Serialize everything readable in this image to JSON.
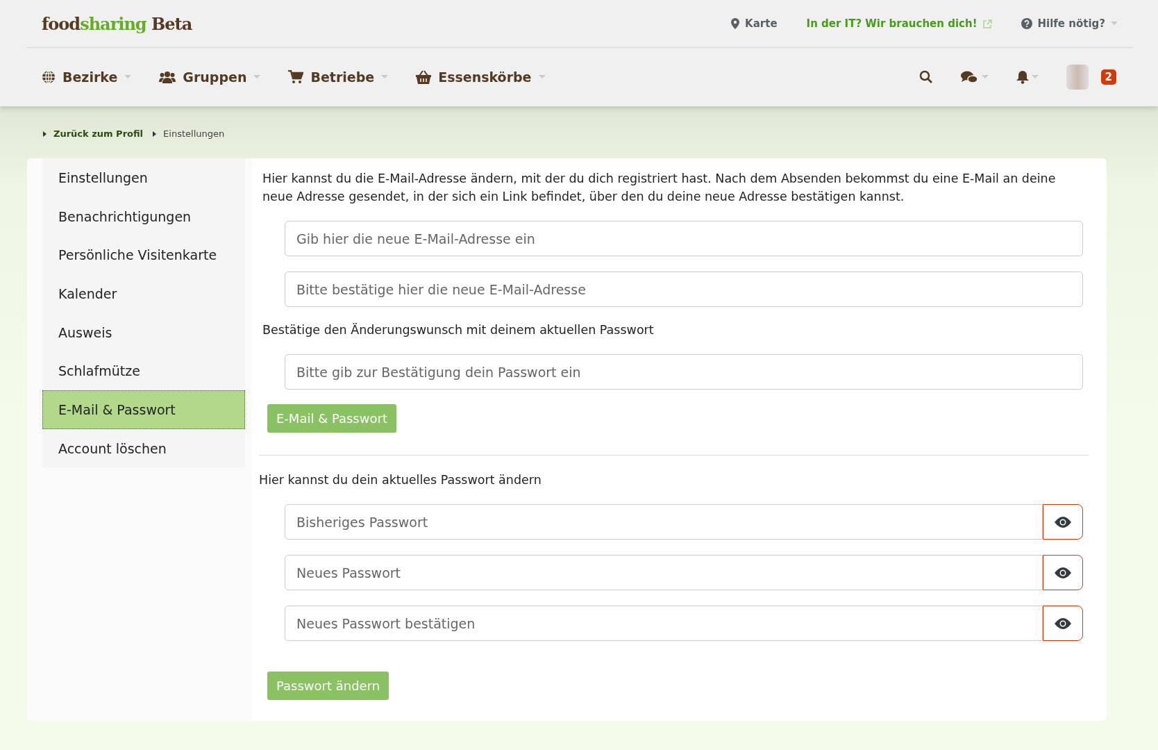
{
  "header": {
    "logo": {
      "parts": [
        {
          "text": "food",
          "accent": false
        },
        {
          "text": "sharing",
          "accent": true
        }
      ],
      "suffix": "Beta"
    },
    "top_links": [
      {
        "kind": "map",
        "label": "Karte"
      },
      {
        "kind": "external",
        "label": "In der IT? Wir brauchen dich!"
      },
      {
        "kind": "help",
        "label": "Hilfe nötig?"
      }
    ],
    "nav": [
      {
        "kind": "districts",
        "label": "Bezirke"
      },
      {
        "kind": "groups",
        "label": "Gruppen"
      },
      {
        "kind": "stores",
        "label": "Betriebe"
      },
      {
        "kind": "baskets",
        "label": "Essenskörbe"
      }
    ],
    "notification_badge": "2"
  },
  "breadcrumbs": [
    {
      "label": "Zurück zum Profil",
      "link": true
    },
    {
      "label": "Einstellungen",
      "link": false
    }
  ],
  "sidebar": {
    "items": [
      {
        "label": "Einstellungen",
        "selected": false
      },
      {
        "label": "Benachrichtigungen",
        "selected": false
      },
      {
        "label": "Persönliche Visitenkarte",
        "selected": false
      },
      {
        "label": "Kalender",
        "selected": false
      },
      {
        "label": "Ausweis",
        "selected": false
      },
      {
        "label": "Schlafmütze",
        "selected": false
      },
      {
        "label": "E-Mail & Passwort",
        "selected": true
      },
      {
        "label": "Account löschen",
        "selected": false
      }
    ]
  },
  "email_form": {
    "intro": "Hier kannst du die E-Mail-Adresse ändern, mit der du dich registriert hast. Nach dem Absenden bekommst du eine E-Mail an deine neue Adresse gesendet, in der sich ein Link befindet, über den du deine neue Adresse bestätigen kannst.",
    "fields": [
      {
        "placeholder": "Gib hier die neue E-Mail-Adresse ein"
      },
      {
        "placeholder": "Bitte bestätige hier die neue E-Mail-Adresse"
      }
    ],
    "password_hint": "Bestätige den Änderungswunsch mit deinem aktuellen Passwort",
    "password_field": {
      "placeholder": "Bitte gib zur Bestätigung dein Passwort ein"
    },
    "submit": "E-Mail & Passwort"
  },
  "password_form": {
    "intro": "Hier kannst du dein aktuelles Passwort ändern",
    "fields": [
      {
        "placeholder": "Bisheriges Passwort"
      },
      {
        "placeholder": "Neues Passwort"
      },
      {
        "placeholder": "Neues Passwort bestätigen"
      }
    ],
    "submit": "Passwort ändern"
  }
}
